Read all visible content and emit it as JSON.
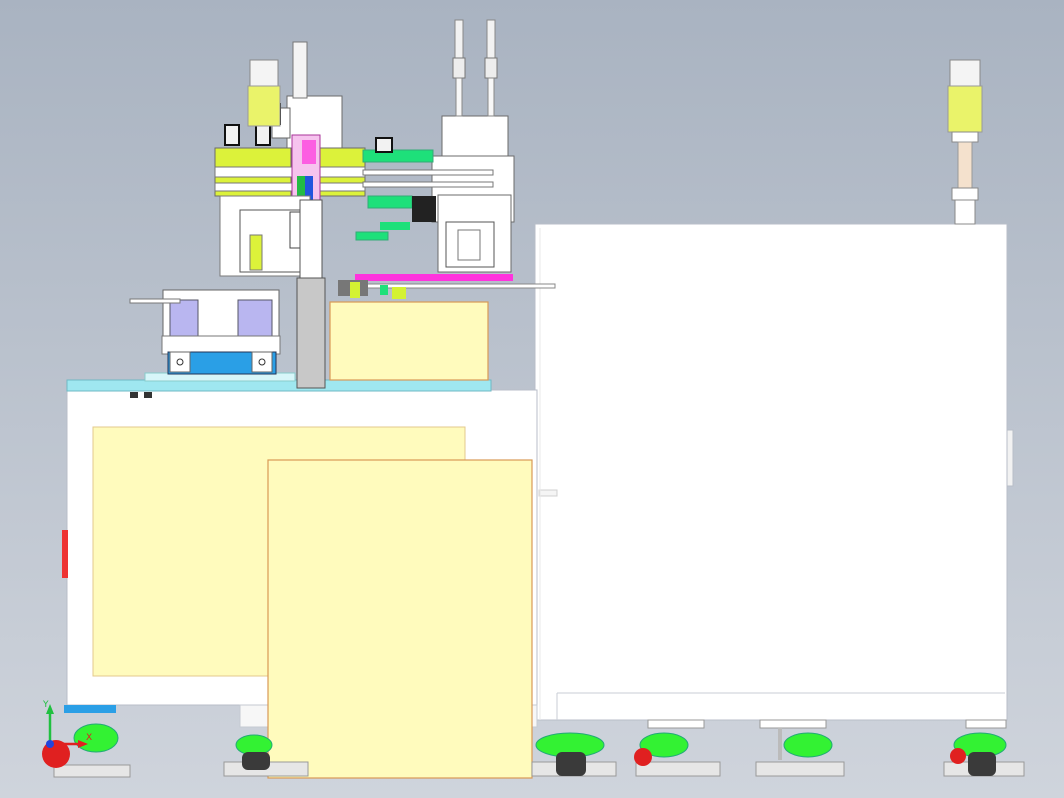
{
  "viewport": {
    "background_top": "#a9b3c1",
    "background_bottom": "#cfd4dc"
  },
  "colors": {
    "frame": "#ffffff",
    "frame_edge": "#b8bec8",
    "panel_fill": "#fffbbd",
    "panel_edge": "#e3b87d",
    "leveling_foot": "#33f233",
    "foot_rubber": "#3a3a3a",
    "mechanism_lime": "#dcf23a",
    "mechanism_green": "#1ee07a",
    "mechanism_magenta": "#ff33dd",
    "mechanism_blue": "#2a9fe6",
    "mechanism_lavender": "#b9b6f0",
    "tower_light": "#eaf36a",
    "table_top": "#9fe7f0"
  },
  "triad": {
    "y_label": "Y",
    "x_label": "X"
  }
}
